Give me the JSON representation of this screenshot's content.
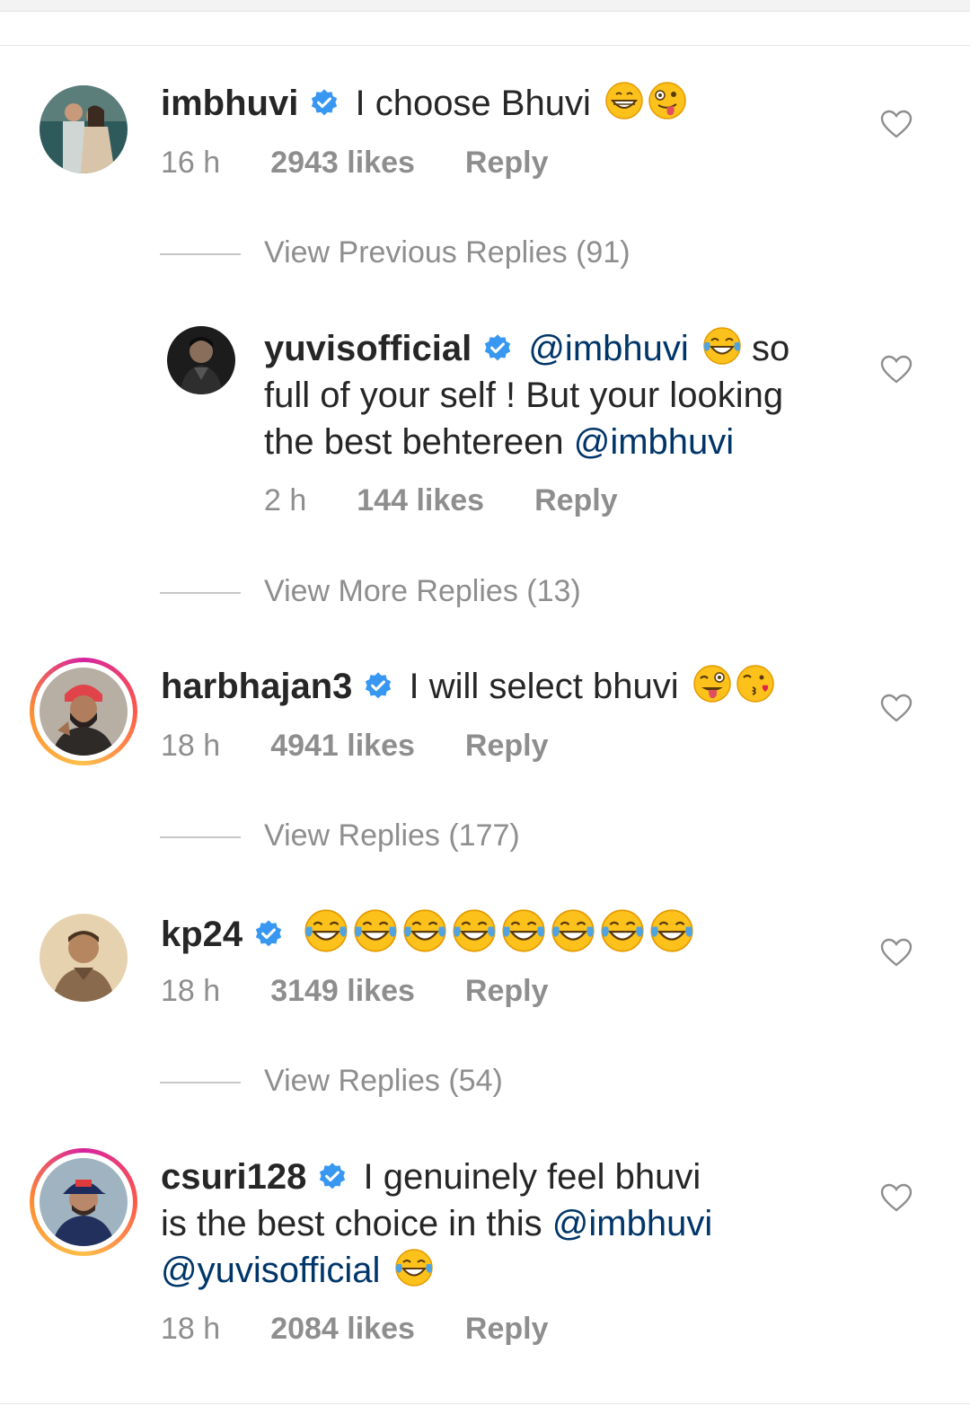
{
  "comments": [
    {
      "username": "imbhuvi",
      "text": "I choose Bhuvi",
      "emoji": [
        "grinning-face",
        "zany-face"
      ],
      "time": "16 h",
      "likes": "2943 likes",
      "reply": "Reply",
      "avatar_icon": "couple-photo-avatar"
    },
    {
      "username": "yuvisofficial",
      "mention1": "@imbhuvi",
      "text1": "so",
      "text2": "full of your self ! But your looking",
      "text3": "the best behtereen",
      "mention2": "@imbhuvi",
      "emoji": [
        "tears-of-joy-face"
      ],
      "time": "2 h",
      "likes": "144 likes",
      "reply": "Reply"
    },
    {
      "username": "harbhajan3",
      "text": "I will select bhuvi",
      "emoji": [
        "winking-tongue-face",
        "kissing-heart-face"
      ],
      "time": "18 h",
      "likes": "4941 likes",
      "reply": "Reply"
    },
    {
      "username": "kp24",
      "emoji_count": 8,
      "emoji": [
        "tears-of-joy-face"
      ],
      "time": "18 h",
      "likes": "3149 likes",
      "reply": "Reply"
    },
    {
      "username": "csuri128",
      "text1": "I genuinely feel bhuvi",
      "text2": "is the best choice in this",
      "mention1": "@imbhuvi",
      "mention2": "@yuvisofficial",
      "emoji": [
        "tears-of-joy-face"
      ],
      "time": "18 h",
      "likes": "2084 likes",
      "reply": "Reply"
    }
  ],
  "view_replies": [
    "View Previous Replies (91)",
    "View More Replies (13)",
    "View Replies (177)",
    "View Replies (54)"
  ],
  "colors": {
    "mention": "#003569",
    "verified": "#3897f0",
    "meta": "#8e8e8e",
    "text": "#262626"
  }
}
